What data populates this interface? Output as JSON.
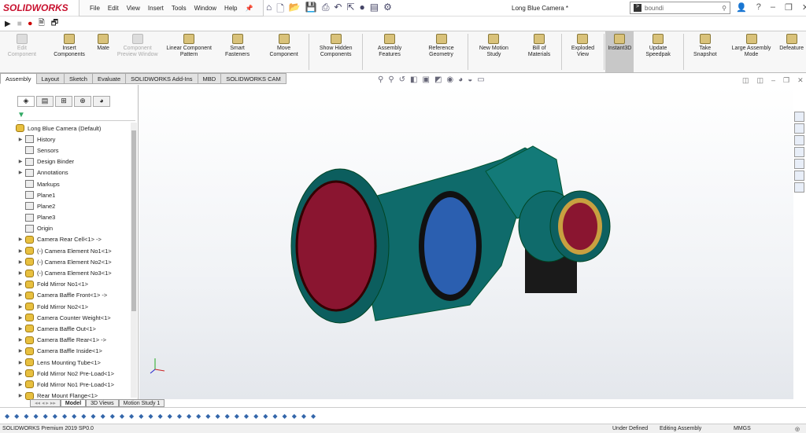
{
  "app": {
    "logo": "SOLIDWORKS",
    "title": "Long Blue Camera *"
  },
  "menu": [
    "File",
    "Edit",
    "View",
    "Insert",
    "Tools",
    "Window",
    "Help"
  ],
  "search": {
    "value": "boundi"
  },
  "ribbon": [
    {
      "label": "Edit Component",
      "state": "disabled"
    },
    {
      "label": "Insert Components",
      "state": "normal"
    },
    {
      "label": "Mate",
      "state": "normal"
    },
    {
      "label": "Component Preview Window",
      "state": "disabled"
    },
    {
      "label": "Linear Component Pattern",
      "state": "normal"
    },
    {
      "label": "Smart Fasteners",
      "state": "normal"
    },
    {
      "label": "Move Component",
      "state": "normal"
    },
    {
      "label": "Show Hidden Components",
      "state": "normal"
    },
    {
      "label": "Assembly Features",
      "state": "normal"
    },
    {
      "label": "Reference Geometry",
      "state": "normal"
    },
    {
      "label": "New Motion Study",
      "state": "normal"
    },
    {
      "label": "Bill of Materials",
      "state": "normal"
    },
    {
      "label": "Exploded View",
      "state": "normal"
    },
    {
      "label": "Instant3D",
      "state": "active"
    },
    {
      "label": "Update Speedpak",
      "state": "normal"
    },
    {
      "label": "Take Snapshot",
      "state": "normal"
    },
    {
      "label": "Large Assembly Mode",
      "state": "normal"
    },
    {
      "label": "Defeature",
      "state": "normal"
    }
  ],
  "tabs": [
    "Assembly",
    "Layout",
    "Sketch",
    "Evaluate",
    "SOLIDWORKS Add-Ins",
    "MBD",
    "SOLIDWORKS CAM"
  ],
  "tree": {
    "root": "Long Blue Camera  (Default)",
    "items": [
      {
        "label": "History",
        "type": "folder",
        "arrow": true
      },
      {
        "label": "Sensors",
        "type": "folder",
        "arrow": false
      },
      {
        "label": "Design Binder",
        "type": "folder",
        "arrow": true
      },
      {
        "label": "Annotations",
        "type": "folder",
        "arrow": true
      },
      {
        "label": "Markups",
        "type": "folder",
        "arrow": false
      },
      {
        "label": "Plane1",
        "type": "plane",
        "arrow": false
      },
      {
        "label": "Plane2",
        "type": "plane",
        "arrow": false
      },
      {
        "label": "Plane3",
        "type": "plane",
        "arrow": false
      },
      {
        "label": "Origin",
        "type": "origin",
        "arrow": false
      },
      {
        "label": "Camera Rear Cell<1> ->",
        "type": "part",
        "arrow": true
      },
      {
        "label": "(-) Camera Element No1<1>",
        "type": "part",
        "arrow": true
      },
      {
        "label": "(-) Camera Element No2<1>",
        "type": "part",
        "arrow": true
      },
      {
        "label": "(-) Camera Element No3<1>",
        "type": "part",
        "arrow": true
      },
      {
        "label": "Fold Mirror No1<1>",
        "type": "part",
        "arrow": true
      },
      {
        "label": "Camera Baffle Front<1> ->",
        "type": "part",
        "arrow": true
      },
      {
        "label": "Fold Mirror No2<1>",
        "type": "part",
        "arrow": true
      },
      {
        "label": "Camera Counter Weight<1>",
        "type": "part",
        "arrow": true
      },
      {
        "label": "Camera Baffle Out<1>",
        "type": "part",
        "arrow": true
      },
      {
        "label": "Camera Baffle Rear<1> ->",
        "type": "part",
        "arrow": true
      },
      {
        "label": "Camera Baffle Inside<1>",
        "type": "part",
        "arrow": true
      },
      {
        "label": "Lens Mounting Tube<1>",
        "type": "part",
        "arrow": true
      },
      {
        "label": "Fold Mirror No2 Pre-Load<1>",
        "type": "part",
        "arrow": true
      },
      {
        "label": "Fold Mirror No1 Pre-Load<1>",
        "type": "part",
        "arrow": true
      },
      {
        "label": "Rear Mount Flange<1>",
        "type": "part",
        "arrow": true
      }
    ]
  },
  "bottom_tabs": [
    "Model",
    "3D Views",
    "Motion Study 1"
  ],
  "status": {
    "left": "SOLIDWORKS Premium 2019 SP0.0",
    "defined": "Under Defined",
    "mode": "Editing Assembly",
    "units": "MMGS"
  },
  "colors": {
    "body": "#0f6b6b",
    "lens_red": "#8a1530",
    "lens_blue": "#2b5fb0",
    "mount": "#1a1a1a"
  }
}
